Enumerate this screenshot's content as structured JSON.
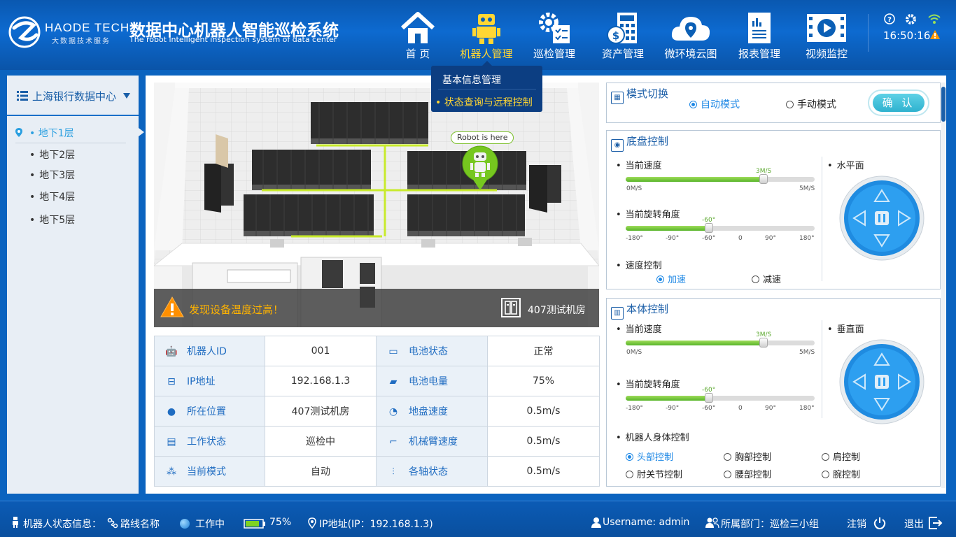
{
  "header": {
    "brand": "HAODE TECH",
    "brand_sub": "大数据技术服务",
    "title": "数据中心机器人智能巡检系统",
    "subtitle": "The robot intelligent inspection system of data center",
    "time": "16:50:16",
    "nav": [
      {
        "label": "首 页",
        "icon": "home-icon"
      },
      {
        "label": "机器人管理",
        "icon": "robot-icon",
        "active": true
      },
      {
        "label": "巡检管理",
        "icon": "gear-checklist-icon"
      },
      {
        "label": "资产管理",
        "icon": "calculator-money-icon"
      },
      {
        "label": "微环境云图",
        "icon": "cloud-map-icon"
      },
      {
        "label": "报表管理",
        "icon": "report-icon"
      },
      {
        "label": "视频监控",
        "icon": "video-icon"
      }
    ],
    "dropdown": {
      "items": [
        "基本信息管理",
        "• 状态查询与远程控制"
      ]
    }
  },
  "sidebar": {
    "title": "上海银行数据中心",
    "floors": [
      "• 地下1层",
      "地下2层",
      "地下3层",
      "地下4层",
      "地下5层"
    ]
  },
  "map": {
    "robot_label": "Robot is here",
    "alert": "发现设备温度过高！",
    "room": "407测试机房"
  },
  "info_table": [
    [
      {
        "label": "机器人ID",
        "icon": "robot-id-icon"
      },
      "001",
      {
        "label": "电池状态",
        "icon": "battery-status-icon"
      },
      "正常"
    ],
    [
      {
        "label": "IP地址",
        "icon": "ip-icon"
      },
      "192.168.1.3",
      {
        "label": "电池电量",
        "icon": "battery-level-icon"
      },
      "75%"
    ],
    [
      {
        "label": "所在位置",
        "icon": "location-icon"
      },
      "407测试机房",
      {
        "label": "地盘速度",
        "icon": "speedometer-icon"
      },
      "0.5m/s"
    ],
    [
      {
        "label": "工作状态",
        "icon": "work-status-icon"
      },
      "巡检中",
      {
        "label": "机械臂速度",
        "icon": "robot-arm-icon"
      },
      "0.5m/s"
    ],
    [
      {
        "label": "当前模式",
        "icon": "mode-icon"
      },
      "自动",
      {
        "label": "各轴状态",
        "icon": "axis-icon"
      },
      "0.5m/s"
    ]
  ],
  "mode_panel": {
    "title": "模式切换",
    "auto": "自动模式",
    "manual": "手动模式",
    "confirm": "确 认"
  },
  "chassis_panel": {
    "title": "底盘控制",
    "speed_label": "当前速度",
    "speed_value": "3M/S",
    "speed_fraction": 0.73,
    "speed_min": "0M/S",
    "speed_max": "5M/S",
    "angle_label": "当前旋转角度",
    "angle_value": "-60°",
    "angle_fraction": 0.44,
    "angle_ticks": [
      "-180°",
      "-90°",
      "-60°",
      "0",
      "90°",
      "180°"
    ],
    "speed_ctrl_label": "速度控制",
    "accel": "加速",
    "decel": "减速",
    "plane_label": "水平面"
  },
  "body_panel": {
    "title": "本体控制",
    "speed_label": "当前速度",
    "speed_value": "3M/S",
    "speed_fraction": 0.73,
    "speed_min": "0M/S",
    "speed_max": "5M/S",
    "angle_label": "当前旋转角度",
    "angle_value": "-60°",
    "angle_fraction": 0.44,
    "angle_ticks": [
      "-180°",
      "-90°",
      "-60°",
      "0",
      "90°",
      "180°"
    ],
    "plane_label": "垂直面",
    "body_ctrl_label": "机器人身体控制",
    "options": [
      "头部控制",
      "胸部控制",
      "肩控制",
      "肘关节控制",
      "腰部控制",
      "腕控制"
    ]
  },
  "footer": {
    "status_label": "机器人状态信息：",
    "route": "路线名称",
    "working": "工作中",
    "battery": "75%",
    "ip": "IP地址(IP：192.168.1.3)",
    "username": "Username: admin",
    "dept": "所属部门：巡检三小组",
    "logout": "注销",
    "exit": "退出"
  },
  "colors": {
    "header_bg": "#0a58b0",
    "accent": "#1e88e5",
    "nav_active": "#ffd633",
    "alert": "#ffb300",
    "slider_fill": "#58b52a"
  }
}
